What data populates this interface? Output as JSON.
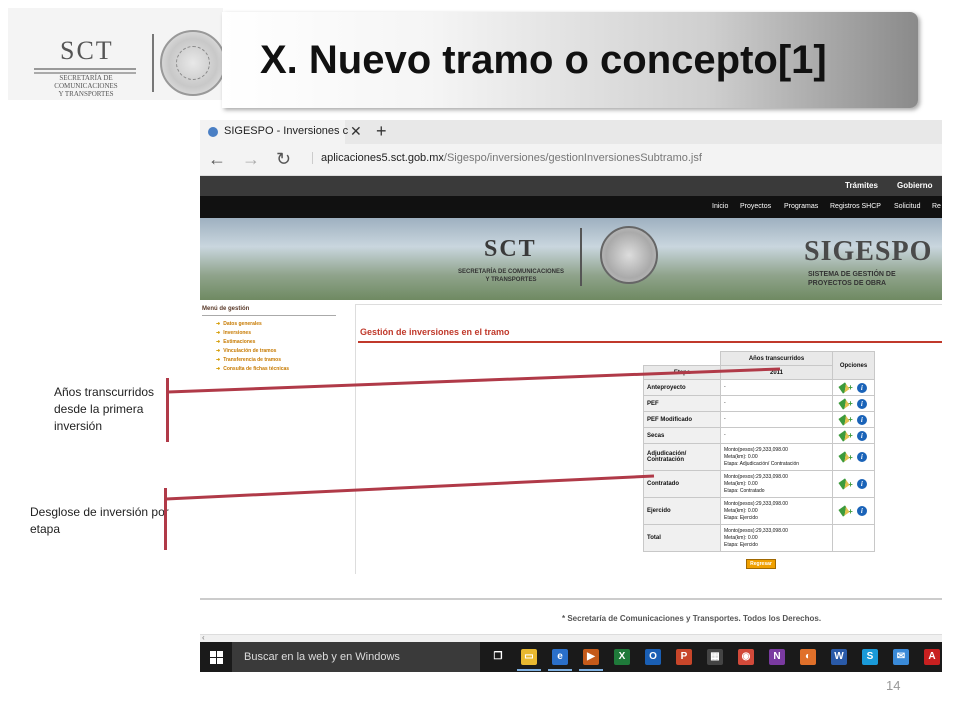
{
  "slide": {
    "title": "X. Nuevo tramo o concepto[1]",
    "page_number": "14",
    "logo": {
      "acronym": "SCT",
      "subtitle_lines": [
        "SECRETARÍA DE",
        "COMUNICACIONES",
        "Y TRANSPORTES"
      ]
    },
    "annotations": [
      {
        "text": "Años transcurridos desde la primera inversión"
      },
      {
        "text": "Desglose de inversión por etapa"
      }
    ],
    "colors": {
      "annotation_line": "#b03a48",
      "accent_red": "#c0392b"
    }
  },
  "browser": {
    "tab_title": "SIGESPO - Inversiones c",
    "address_domain": "aplicaciones5.sct.gob.mx",
    "address_path": "/Sigespo/inversiones/gestionInversionesSubtramo.jsf",
    "close_glyph": "✕",
    "new_tab_glyph": "+"
  },
  "site": {
    "gov_links": [
      "Trámites",
      "Gobierno"
    ],
    "menu": [
      "Inicio",
      "Proyectos",
      "Programas",
      "Registros SHCP",
      "Solicitud",
      "Re"
    ],
    "banner": {
      "sct": "SCT",
      "sct_sub": "SECRETARÍA DE COMUNICACIONES Y TRANSPORTES",
      "sigespo": "SIGESPO",
      "sigespo_sub": "SISTEMA DE GESTIÓN DE PROYECTOS DE OBRA"
    },
    "sidebar": {
      "title": "Menú de gestión",
      "items": [
        "Datos generales",
        "Inversiones",
        "Estimaciones",
        "Vinculación de tramos",
        "Transferencia de tramos",
        "Consulta de fichas técnicas"
      ]
    },
    "content_title": "Gestión de inversiones en el tramo",
    "table": {
      "header_group": "Años transcurridos",
      "col_etapa": "Etapa",
      "col_year": "2011",
      "col_opciones": "Opciones",
      "rows": [
        {
          "etapa": "Anteproyecto",
          "value": [
            "-"
          ],
          "options": true
        },
        {
          "etapa": "PEF",
          "value": [
            "-"
          ],
          "options": true
        },
        {
          "etapa": "PEF Modificado",
          "value": [
            "-"
          ],
          "options": true
        },
        {
          "etapa": "Secas",
          "value": [
            "-"
          ],
          "options": true
        },
        {
          "etapa": "Adjudicación/ Contratación",
          "value": [
            "Monto(pesos):29,333,098.00",
            "Meta(km):      0.00",
            "Etapa:         Adjudicación/ Contratación"
          ],
          "options": true
        },
        {
          "etapa": "Contratado",
          "value": [
            "Monto(pesos):29,333,098.00",
            "Meta(km):      0.00",
            "Etapa:         Contratado"
          ],
          "options": true
        },
        {
          "etapa": "Ejercido",
          "value": [
            "Monto(pesos):29,333,098.00",
            "Meta(km):      0.00",
            "Etapa:         Ejercido"
          ],
          "options": true
        },
        {
          "etapa": "Total",
          "value": [
            "Monto(pesos):29,333,098.00",
            "Meta(km):      0.00",
            "Etapa:         Ejercido"
          ],
          "options": false
        }
      ]
    },
    "back_button": "Regresar",
    "footer": "* Secretaría de Comunicaciones y Transportes. Todos los Derechos."
  },
  "taskbar": {
    "search_placeholder": "Buscar en la web y en Windows",
    "apps": [
      {
        "name": "task-view",
        "glyph": "❐",
        "color": "#1a1a1a"
      },
      {
        "name": "file-explorer",
        "glyph": "▭",
        "color": "#e8b830"
      },
      {
        "name": "edge",
        "glyph": "e",
        "color": "#2a6fc9"
      },
      {
        "name": "media",
        "glyph": "▶",
        "color": "#c45a1a"
      },
      {
        "name": "excel",
        "glyph": "X",
        "color": "#1f7a3a"
      },
      {
        "name": "outlook",
        "glyph": "O",
        "color": "#1a5fb4"
      },
      {
        "name": "powerpoint",
        "glyph": "P",
        "color": "#c8462a"
      },
      {
        "name": "store",
        "glyph": "▦",
        "color": "#444"
      },
      {
        "name": "chrome",
        "glyph": "◉",
        "color": "#d24a3a"
      },
      {
        "name": "onenote",
        "glyph": "N",
        "color": "#7a3aa0"
      },
      {
        "name": "firefox",
        "glyph": "◐",
        "color": "#e0702a"
      },
      {
        "name": "word",
        "glyph": "W",
        "color": "#2a5aa8"
      },
      {
        "name": "skype",
        "glyph": "S",
        "color": "#1a9ad8"
      },
      {
        "name": "mail",
        "glyph": "✉",
        "color": "#3a8ad8"
      },
      {
        "name": "acrobat",
        "glyph": "A",
        "color": "#c82020"
      }
    ]
  }
}
